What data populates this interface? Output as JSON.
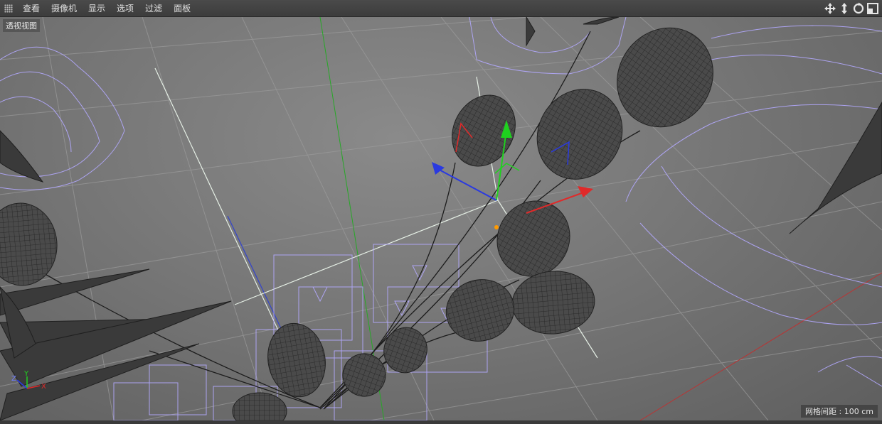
{
  "menubar": {
    "items": [
      "查看",
      "摄像机",
      "显示",
      "选项",
      "过滤",
      "面板"
    ],
    "nav_icons": [
      "move-view-icon",
      "dolly-view-icon",
      "rotate-view-icon",
      "toggle-layout-icon"
    ]
  },
  "viewport": {
    "label": "透视视图",
    "grid_spacing": "网格间距 : 100 cm",
    "axis_gizmo": {
      "x": "X",
      "y": "Y",
      "z": "Z"
    }
  },
  "colors": {
    "menubar": "#444444",
    "viewport_bg": "#7a7a7a",
    "wireframe": "#b0a8ff",
    "grid": "#9a9a9a",
    "axis_x": "#e02a2a",
    "axis_y": "#1fd11f",
    "axis_z": "#2a3ae0",
    "balloon": "#4a4a4a"
  }
}
